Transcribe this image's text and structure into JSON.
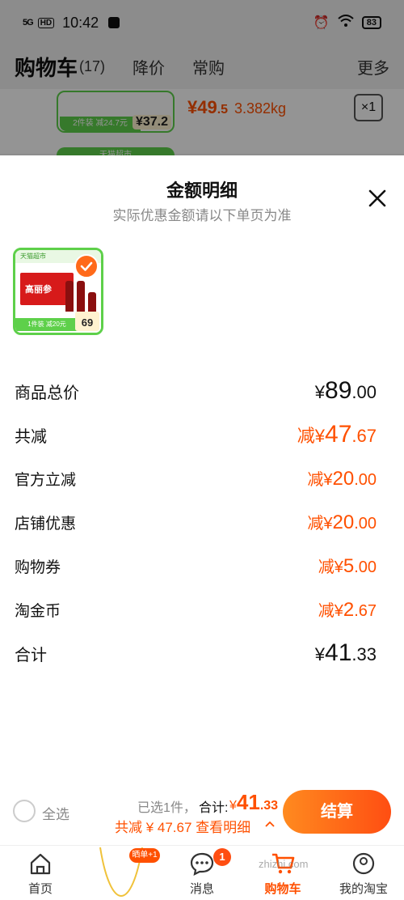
{
  "status_bar": {
    "signal": "5G",
    "hd": "HD",
    "time": "10:42",
    "battery": "83"
  },
  "background_page": {
    "title": "购物车",
    "count": "(17)",
    "tabs": [
      "降价",
      "常购"
    ],
    "more": "更多",
    "product": {
      "tag_text": "2件装 减24.7元",
      "tag_price": "¥37.2",
      "price_int": "¥49",
      "price_dec": ".5",
      "weight": "3.382kg",
      "quantity": "×1"
    },
    "next_title": "天猫超市"
  },
  "sheet": {
    "title": "金额明细",
    "subtitle": "实际优惠金额请以下单页为准",
    "thumb": {
      "top_text": "天猫超市",
      "box_label": "高丽参",
      "strip_left": "1件装 减20元",
      "strip_price": "69"
    },
    "rows": [
      {
        "label": "商品总价",
        "prefix": "¥",
        "int": "89",
        "dec": ".00"
      },
      {
        "label": "共减",
        "prefix": "减¥",
        "int": "47",
        "dec": ".67"
      },
      {
        "label": "官方立减",
        "prefix": "减¥",
        "int": "20",
        "dec": ".00"
      },
      {
        "label": "店铺优惠",
        "prefix": "减¥",
        "int": "20",
        "dec": ".00"
      },
      {
        "label": "购物券",
        "prefix": "减¥",
        "int": "5",
        "dec": ".00"
      },
      {
        "label": "淘金币",
        "prefix": "减¥",
        "int": "2",
        "dec": ".67"
      },
      {
        "label": "合计",
        "prefix": "¥",
        "int": "41",
        "dec": ".33"
      }
    ]
  },
  "action_bar": {
    "select_all": "全选",
    "selected": "已选1件，",
    "total_label": "合计:",
    "total_prefix": "¥",
    "total_int": "41",
    "total_dec": ".33",
    "discount": "共减 ¥ 47.67  查看明细",
    "checkout": "结算"
  },
  "tab_bar": {
    "items": [
      "首页",
      "",
      "消息",
      "购物车",
      "我的淘宝"
    ],
    "message_badge": "1",
    "promo_chip": "晒单+1"
  },
  "watermark": "zhizhi.com",
  "colors": {
    "accent": "#ff5000",
    "green": "#5ed04a"
  }
}
